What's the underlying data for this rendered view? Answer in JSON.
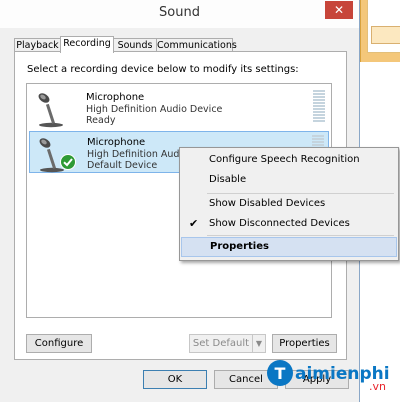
{
  "window": {
    "title": "Sound",
    "close_label": "✕"
  },
  "tabs": [
    {
      "label": "Playback"
    },
    {
      "label": "Recording"
    },
    {
      "label": "Sounds"
    },
    {
      "label": "Communications"
    }
  ],
  "instruction": "Select a recording device below to modify its settings:",
  "devices": [
    {
      "name": "Microphone",
      "description": "High Definition Audio Device",
      "status": "Ready"
    },
    {
      "name": "Microphone",
      "description": "High Definition Audio Device",
      "status": "Default Device"
    }
  ],
  "buttons": {
    "configure": "Configure",
    "set_default": "Set Default",
    "properties": "Properties",
    "ok": "OK",
    "cancel": "Cancel",
    "apply": "Apply"
  },
  "context_menu": [
    {
      "label": "Configure Speech Recognition",
      "checked": false
    },
    {
      "label": "Disable",
      "checked": false
    },
    {
      "label": "Show Disabled Devices",
      "checked": false
    },
    {
      "label": "Show Disconnected Devices",
      "checked": true
    },
    {
      "label": "Properties",
      "checked": false,
      "highlighted": true
    }
  ],
  "watermark": {
    "text_main": "aimienphi",
    "text_sub": ".vn"
  },
  "colors": {
    "accent": "#0078d7",
    "selection": "#cde8f8",
    "menu_highlight": "#d5e1f2",
    "close": "#c7453a"
  }
}
